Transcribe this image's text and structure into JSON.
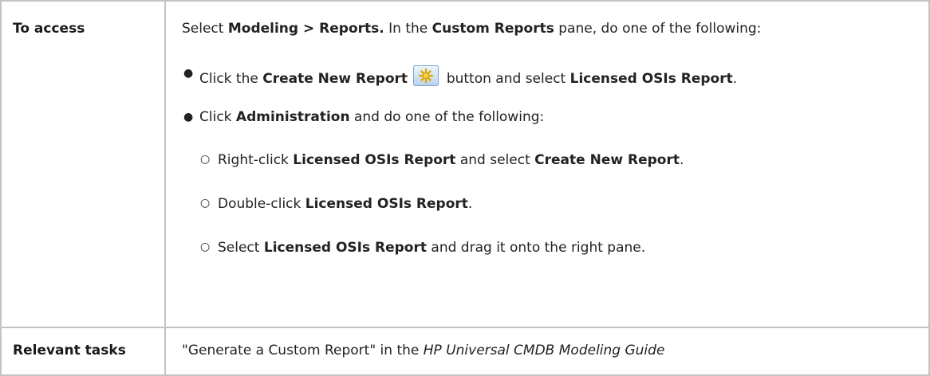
{
  "access": {
    "label": "To access",
    "intro": {
      "t1": "Select ",
      "b1": "Modeling > Reports.",
      "t2": " In the ",
      "b2": "Custom Reports",
      "t3": " pane, do one of the following:"
    },
    "bullet1": {
      "t1": "Click the ",
      "b1": "Create New Report",
      "t2": " button and select ",
      "b2": "Licensed OSIs Report",
      "t3": "."
    },
    "bullet2": {
      "t1": "Click ",
      "b1": "Administration",
      "t2": " and do one of the following:"
    },
    "sub1": {
      "t1": "Right-click ",
      "b1": "Licensed OSIs Report",
      "t2": " and select ",
      "b2": "Create New Report",
      "t3": "."
    },
    "sub2": {
      "t1": "Double-click ",
      "b1": "Licensed OSIs Report",
      "t2": "."
    },
    "sub3": {
      "t1": "Select ",
      "b1": "Licensed OSIs Report",
      "t2": " and drag it onto the right pane."
    }
  },
  "tasks": {
    "label": "Relevant tasks",
    "t1": "\"Generate a Custom Report\" in the ",
    "i1": "HP Universal CMDB Modeling Guide"
  },
  "icons": {
    "new_report": "create-new-report-icon"
  }
}
